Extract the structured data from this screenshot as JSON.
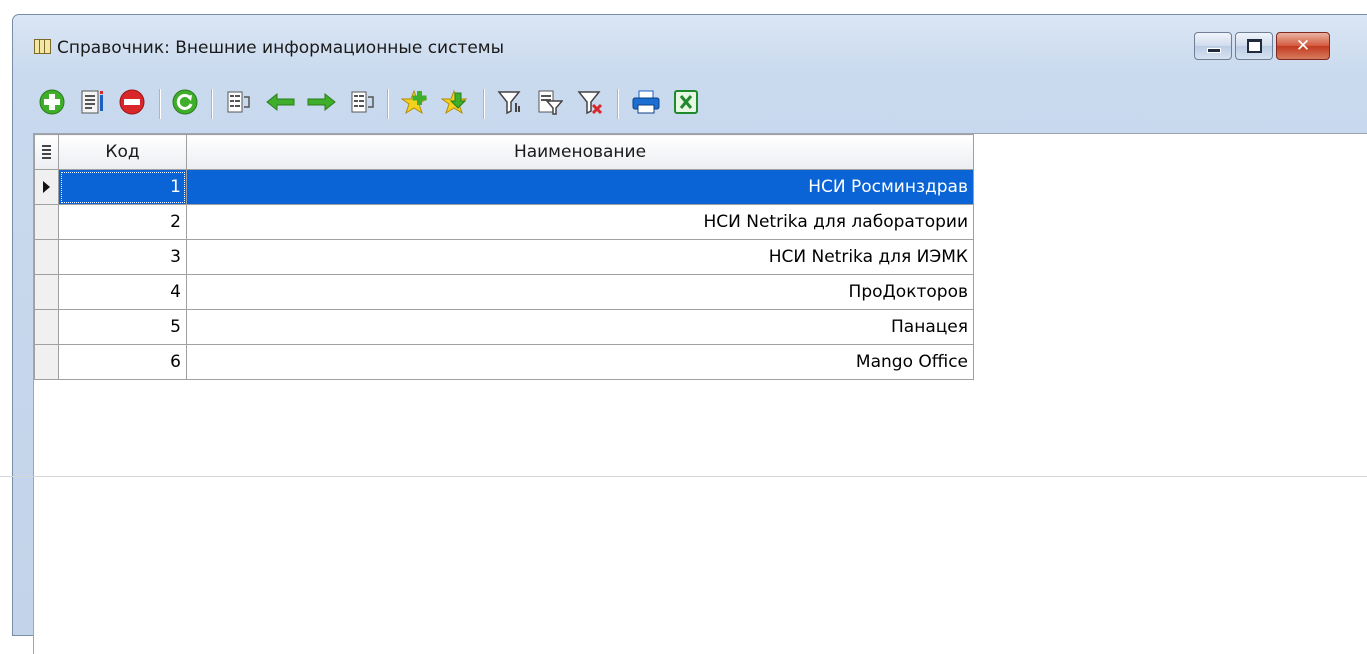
{
  "window": {
    "title": "Справочник: Внешние информационные системы",
    "close_label": "✕"
  },
  "toolbar": {
    "buttons": [
      {
        "icon": "add-icon"
      },
      {
        "icon": "edit-icon"
      },
      {
        "icon": "delete-icon"
      },
      {
        "icon": "refresh-icon"
      },
      {
        "icon": "columns-icon"
      },
      {
        "icon": "arrow-left-icon"
      },
      {
        "icon": "arrow-right-icon"
      },
      {
        "icon": "columns-alt-icon"
      },
      {
        "icon": "star-add-icon"
      },
      {
        "icon": "star-down-icon"
      },
      {
        "icon": "filter-icon"
      },
      {
        "icon": "filter-edit-icon"
      },
      {
        "icon": "filter-clear-icon"
      },
      {
        "icon": "print-icon"
      },
      {
        "icon": "excel-icon"
      }
    ]
  },
  "grid": {
    "columns": [
      "Код",
      "Наименование"
    ],
    "rows": [
      {
        "kod": "1",
        "name": "НСИ Росминздрав"
      },
      {
        "kod": "2",
        "name": "НСИ Netrika для лаборатории"
      },
      {
        "kod": "3",
        "name": "НСИ Netrika для ИЭМК"
      },
      {
        "kod": "4",
        "name": "ПроДокторов"
      },
      {
        "kod": "5",
        "name": "Панацея"
      },
      {
        "kod": "6",
        "name": "Mango Office"
      }
    ],
    "selected_row": 0
  },
  "colors": {
    "selection": "#0a64d6",
    "close_button": "#c23b20",
    "green": "#3fae2a",
    "red": "#d8262a"
  }
}
